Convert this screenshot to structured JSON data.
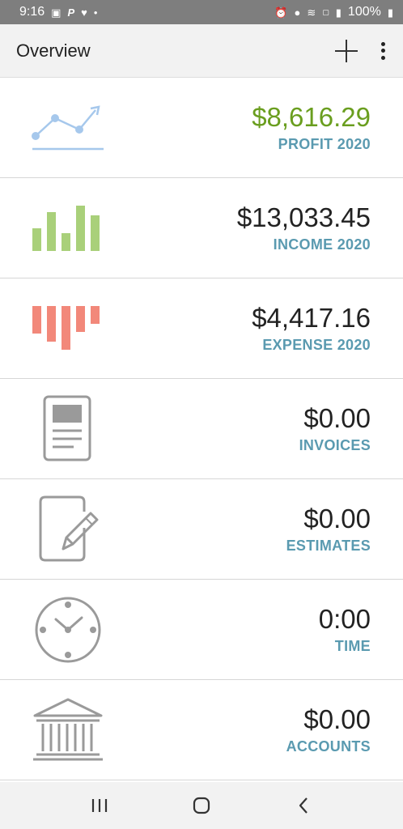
{
  "status_bar": {
    "time": "9:16",
    "battery": "100%",
    "left_icons": [
      "gallery-icon",
      "paypal-icon",
      "heart-icon",
      "dot-icon"
    ],
    "right_icons": [
      "alarm-icon",
      "location-icon",
      "wifi-icon",
      "volte-icon",
      "signal-icon",
      "battery-icon"
    ]
  },
  "app_bar": {
    "title": "Overview",
    "actions": [
      "add-icon",
      "more-vert-icon"
    ]
  },
  "items": [
    {
      "value": "$8,616.29",
      "label": "PROFIT 2020",
      "icon": "profit-trend-icon",
      "value_color": "#6a9e1f"
    },
    {
      "value": "$13,033.45",
      "label": "INCOME 2020",
      "icon": "income-bars-icon"
    },
    {
      "value": "$4,417.16",
      "label": "EXPENSE 2020",
      "icon": "expense-bars-icon"
    },
    {
      "value": "$0.00",
      "label": "INVOICES",
      "icon": "invoice-document-icon"
    },
    {
      "value": "$0.00",
      "label": "ESTIMATES",
      "icon": "estimate-pencil-icon"
    },
    {
      "value": "0:00",
      "label": "TIME",
      "icon": "clock-icon"
    },
    {
      "value": "$0.00",
      "label": "ACCOUNTS",
      "icon": "bank-icon"
    }
  ],
  "nav_bar": {
    "buttons": [
      "recent-apps-icon",
      "home-icon",
      "back-icon"
    ]
  },
  "colors": {
    "profit": "#6a9e1f",
    "label": "#5a9ab0",
    "income_bars": "#a9d07a",
    "expense_bars": "#f2887a",
    "trend_line": "#a6c8ec"
  }
}
